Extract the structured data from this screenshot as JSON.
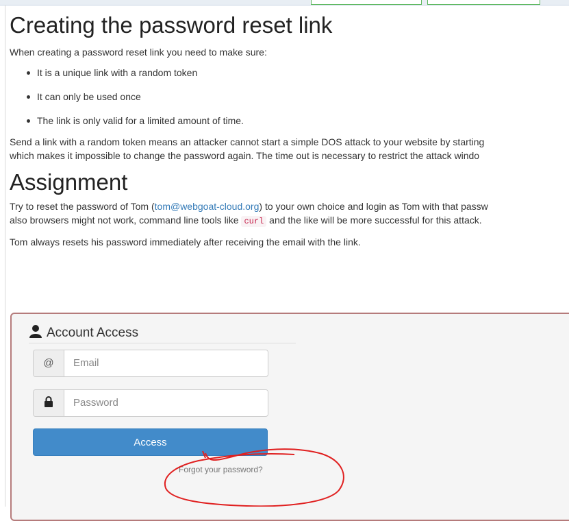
{
  "lesson": {
    "title": "Creating the password reset link",
    "intro": "When creating a password reset link you need to make sure:",
    "bullets": [
      "It is a unique link with a random token",
      "It can only be used once",
      "The link is only valid for a limited amount of time."
    ],
    "para_line1": "Send a link with a random token means an attacker cannot start a simple DOS attack to your website by starting",
    "para_line2": "which makes it impossible to change the password again. The time out is necessary to restrict the attack windo"
  },
  "assignment": {
    "heading": "Assignment",
    "line1_pre": "Try to reset the password of Tom (",
    "email_link": "tom@webgoat-cloud.org",
    "line1_post": ") to your own choice and login as Tom with that passw",
    "line2_pre": "also browsers might not work, command line tools like ",
    "code": "curl",
    "line2_post": " and the like will be more successful for this attack.",
    "note": "Tom always resets his password immediately after receiving the email with the link."
  },
  "login_panel": {
    "heading": "Account Access",
    "email_addon": "@",
    "email_placeholder": "Email",
    "password_placeholder": "Password",
    "access_button": "Access",
    "forgot_link": "Forgot your password?"
  },
  "colors": {
    "panel_border": "#b57b7b",
    "button": "#428bca",
    "link": "#337ab7",
    "annotation": "#e02020"
  },
  "icons": [
    "user-icon",
    "lock-icon"
  ]
}
